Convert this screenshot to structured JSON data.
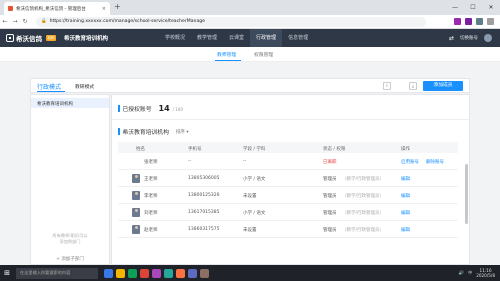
{
  "browser": {
    "tab_title": "希沃信鸽机构_希沃信鸽 - 管理后台",
    "tab_close": "×",
    "new_tab": "+",
    "url": "https://training.xxxxxx.com/manage/school-service/teacherManage",
    "window_controls": [
      "—",
      "☐",
      "✕"
    ],
    "ext_colors": [
      "#9c27b0",
      "#7b1fa2",
      "#607d8b",
      "#9e9e9e"
    ]
  },
  "header": {
    "logo_text": "希沃信鸽",
    "logo_badge": "机构",
    "org_name": "希沃教育培训机构",
    "nav": [
      {
        "label": "学校概况",
        "active": false
      },
      {
        "label": "教学管理",
        "active": false
      },
      {
        "label": "云课堂",
        "active": false
      },
      {
        "label": "行政管理",
        "active": true
      },
      {
        "label": "信息管理",
        "active": false
      }
    ],
    "user_label": "切换账号"
  },
  "subnav": {
    "items": [
      {
        "label": "教师管理",
        "active": true
      },
      {
        "label": "权限管理",
        "active": false
      }
    ]
  },
  "toolbar": {
    "tab_active": "行政模式",
    "tab_other": "教研模式",
    "search_icon": "⌕",
    "download_icon": "⤓",
    "primary_label": "添加成员"
  },
  "left_panel": {
    "selected_item": "希沃教育培训机构",
    "hint_lines": [
      "所有教师/职员可以",
      "添加到部门"
    ],
    "add_dept": "+ 添加子部门"
  },
  "right_panel": {
    "stat_label": "已授权账号",
    "stat_value": "14",
    "stat_total": "/ 100",
    "section_title": "希沃教育培训机构",
    "sort_label": "排序 ▾",
    "columns": [
      "姓名",
      "手机号",
      "学段 / 学科",
      "状态 / 权限",
      "操作"
    ],
    "rows": [
      {
        "name": "张老师",
        "phone": "--",
        "subject": "--",
        "status": "已离职",
        "role": "",
        "action": "启用账号",
        "action2": "删除账号",
        "avatar": false
      },
      {
        "name": "王老师",
        "phone": "13805306005",
        "subject": "小学 / 语文",
        "status": "管理员",
        "role": "（教学/行政管理员）",
        "action": "编辑",
        "action2": "",
        "avatar": true
      },
      {
        "name": "李老师",
        "phone": "13800125326",
        "subject": "未设置",
        "status": "管理员",
        "role": "（教学/行政管理员）",
        "action": "编辑",
        "action2": "",
        "avatar": true
      },
      {
        "name": "刘老师",
        "phone": "13617015385",
        "subject": "小学 / 语文",
        "status": "管理员",
        "role": "（教学/行政管理员）",
        "action": "编辑",
        "action2": "",
        "avatar": true
      },
      {
        "name": "赵老师",
        "phone": "13860317575",
        "subject": "未设置",
        "status": "管理员",
        "role": "（教学/行政管理员）",
        "action": "编辑",
        "action2": "",
        "avatar": true
      }
    ]
  },
  "taskbar": {
    "search_placeholder": "在这里输入你要搜索的内容",
    "start_icon": "⊞",
    "task_colors": [
      "#3b78e7",
      "#f4b400",
      "#0f9d58",
      "#db4437",
      "#ab47bc",
      "#26a69a",
      "#ff7043",
      "#5c6bc0",
      "#8d6e63"
    ],
    "time": "11:16",
    "date": "2020/5/8",
    "lang": "中"
  }
}
